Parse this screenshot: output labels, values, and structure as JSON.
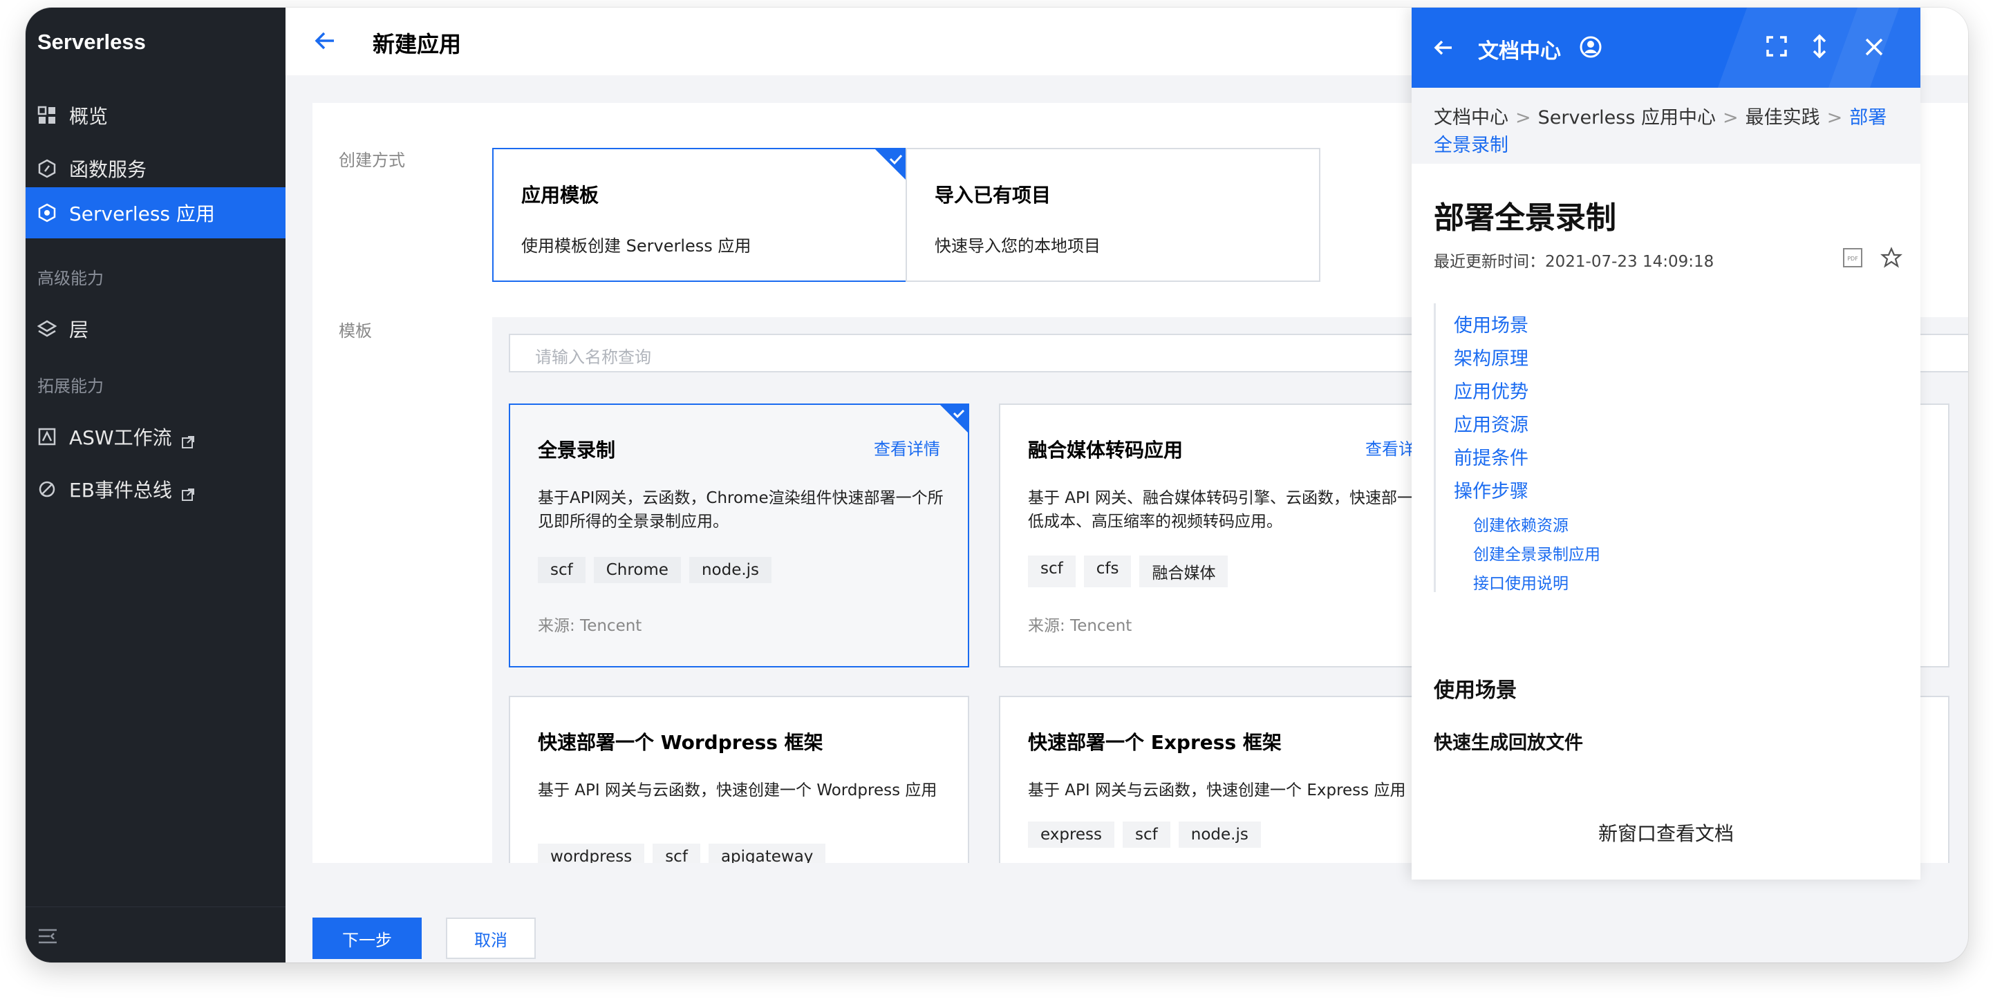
{
  "sidebar": {
    "brand": "Serverless",
    "items": [
      {
        "label": "概览"
      },
      {
        "label": "函数服务"
      },
      {
        "label": "Serverless 应用"
      },
      {
        "label": "层"
      },
      {
        "label": "ASW工作流"
      },
      {
        "label": "EB事件总线"
      }
    ],
    "groups": [
      "高级能力",
      "拓展能力"
    ]
  },
  "header": {
    "title": "新建应用"
  },
  "form": {
    "method_label": "创建方式",
    "template_label": "模板",
    "methods": [
      {
        "title": "应用模板",
        "desc": "使用模板创建 Serverless 应用"
      },
      {
        "title": "导入已有项目",
        "desc": "快速导入您的本地项目"
      }
    ],
    "search_placeholder": "请输入名称查询",
    "templates": [
      {
        "title": "全景录制",
        "detail": "查看详情",
        "desc": "基于API网关，云函数，Chrome渲染组件快速部署一个所见即所得的全景录制应用。",
        "tags": [
          "scf",
          "Chrome",
          "node.js"
        ],
        "source": "来源: Tencent"
      },
      {
        "title": "融合媒体转码应用",
        "detail": "查看详",
        "desc": "基于 API 网关、融合媒体转码引擎、云函数，快速部一个低成本、高压缩率的视频转码应用。",
        "tags": [
          "scf",
          "cfs",
          "融合媒体"
        ],
        "source": "来源: Tencent"
      },
      {
        "title": "快速部署一个 Wordpress 框架",
        "desc": "基于 API 网关与云函数，快速创建一个 Wordpress 应用",
        "tags": [
          "wordpress",
          "scf",
          "apigateway"
        ]
      },
      {
        "title": "快速部署一个 Express 框架",
        "desc": "基于 API 网关与云函数，快速创建一个 Express 应用",
        "tags": [
          "express",
          "scf",
          "node.js"
        ]
      }
    ]
  },
  "buttons": {
    "next": "下一步",
    "cancel": "取消"
  },
  "doc": {
    "title": "文档中心",
    "breadcrumb": [
      "文档中心",
      "Serverless 应用中心",
      "最佳实践",
      "部署全景录制"
    ],
    "heading": "部署全景录制",
    "updated": "最近更新时间：2021-07-23 14:09:18",
    "toc": [
      "使用场景",
      "架构原理",
      "应用优势",
      "应用资源",
      "前提条件",
      "操作步骤"
    ],
    "toc_sub": [
      "创建依赖资源",
      "创建全景录制应用",
      "接口使用说明"
    ],
    "section_title": "使用场景",
    "subsection_title": "快速生成回放文件",
    "open_new_window": "新窗口查看文档"
  },
  "colors": {
    "accent": "#1a6bf0",
    "sidebar_bg": "#1f2329"
  }
}
